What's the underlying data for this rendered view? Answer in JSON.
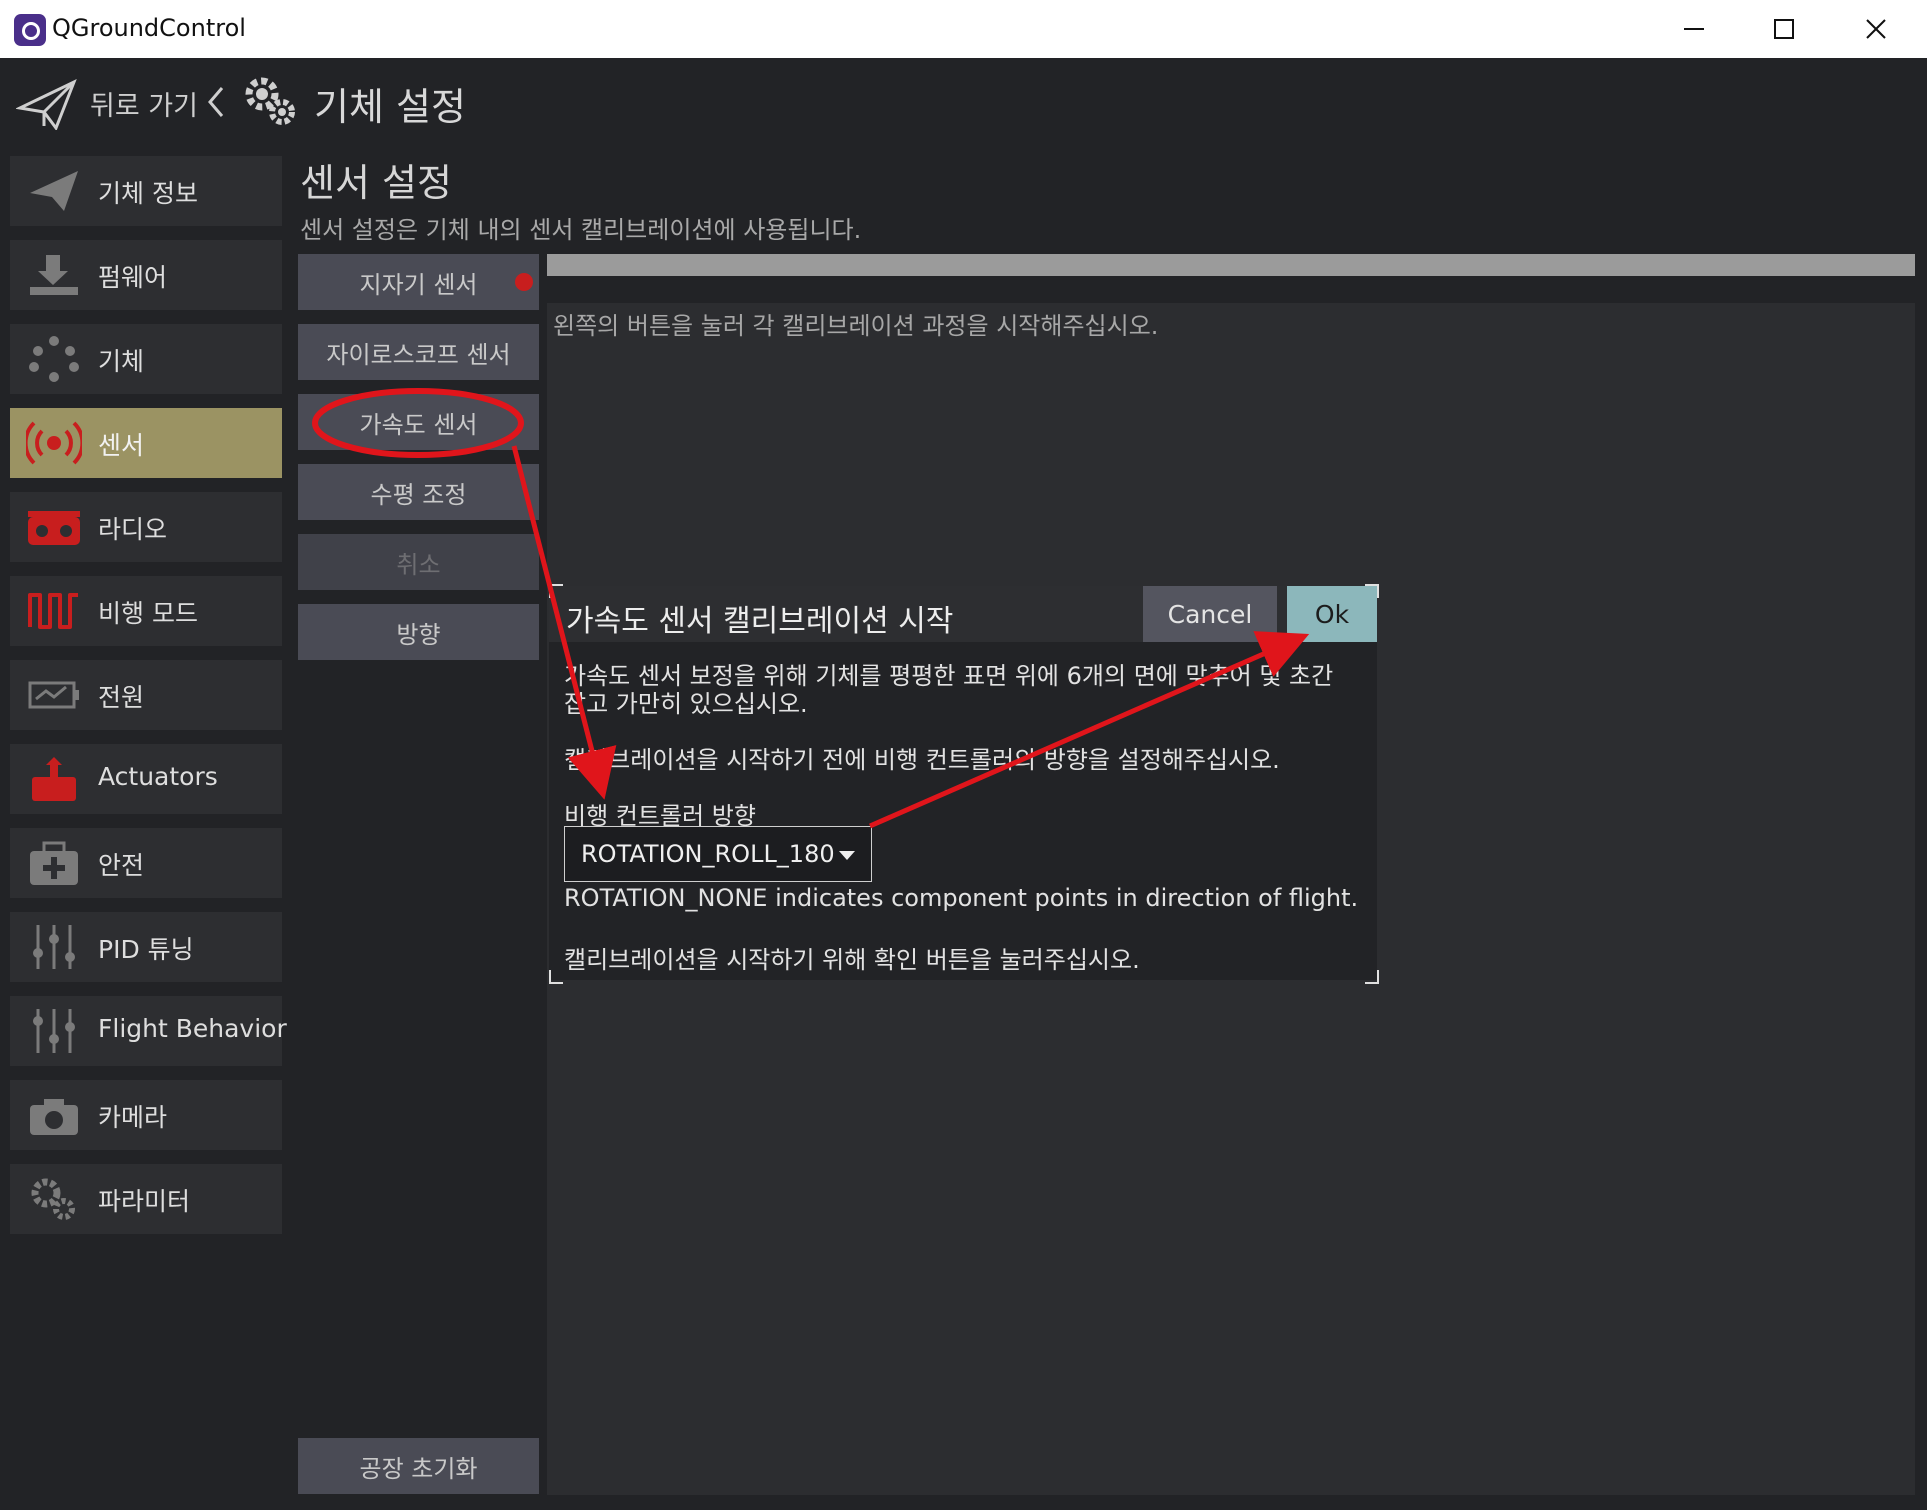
{
  "window": {
    "title": "QGroundControl"
  },
  "header": {
    "back_label": "뒤로 가기",
    "title": "기체 설정"
  },
  "sidebar": {
    "items": [
      {
        "label": "기체 정보",
        "icon": "paper-plane-icon",
        "active": false
      },
      {
        "label": "펌웨어",
        "icon": "download-icon",
        "active": false
      },
      {
        "label": "기체",
        "icon": "airframe-icon",
        "active": false
      },
      {
        "label": "센서",
        "icon": "sensor-icon",
        "active": true
      },
      {
        "label": "라디오",
        "icon": "radio-icon",
        "active": false
      },
      {
        "label": "비행 모드",
        "icon": "flight-mode-icon",
        "active": false
      },
      {
        "label": "전원",
        "icon": "battery-icon",
        "active": false
      },
      {
        "label": "Actuators",
        "icon": "actuator-icon",
        "active": false
      },
      {
        "label": "안전",
        "icon": "safety-icon",
        "active": false
      },
      {
        "label": "PID 튜닝",
        "icon": "tuning-sliders-icon",
        "active": false
      },
      {
        "label": "Flight Behavior",
        "icon": "sliders-icon",
        "active": false
      },
      {
        "label": "카메라",
        "icon": "camera-icon",
        "active": false
      },
      {
        "label": "파라미터",
        "icon": "gears-icon",
        "active": false
      }
    ]
  },
  "sensors": {
    "title": "센서 설정",
    "description": "센서 설정은 기체 내의 센서 캘리브레이션에 사용됩니다.",
    "buttons": {
      "compass": "지자기 센서",
      "gyro": "자이로스코프 센서",
      "accel": "가속도 센서",
      "level": "수평 조정",
      "cancel": "취소",
      "orientation": "방향"
    },
    "reset": "공장 초기화",
    "instruction": "왼쪽의 버튼을 눌러 각 캘리브레이션 과정을 시작해주십시오."
  },
  "dialog": {
    "title": "가속도 센서 캘리브레이션 시작",
    "cancel": "Cancel",
    "ok": "Ok",
    "line1": "가속도 센서 보정을 위해 기체를 평평한 표면 위에 6개의 면에 맞추어 몇 초간",
    "line2": "잡고 가만히 있으십시오.",
    "line3": "캘리브레이션을 시작하기 전에 비행 컨트롤러의 방향을 설정해주십시오.",
    "orientation_label": "비행 컨트롤러 방향",
    "orientation_value": "ROTATION_ROLL_180",
    "orientation_help": "ROTATION_NONE indicates component points in direction of flight.",
    "confirm_text": "캘리브레이션을 시작하기 위해 확인 버튼을 눌러주십시오."
  },
  "colors": {
    "background": "#222326",
    "sidebar_active": "#9b9363",
    "button": "#4a4b55",
    "ok": "#8cb7bb",
    "annotation": "#e0151b",
    "status_red": "#c81e1e"
  }
}
